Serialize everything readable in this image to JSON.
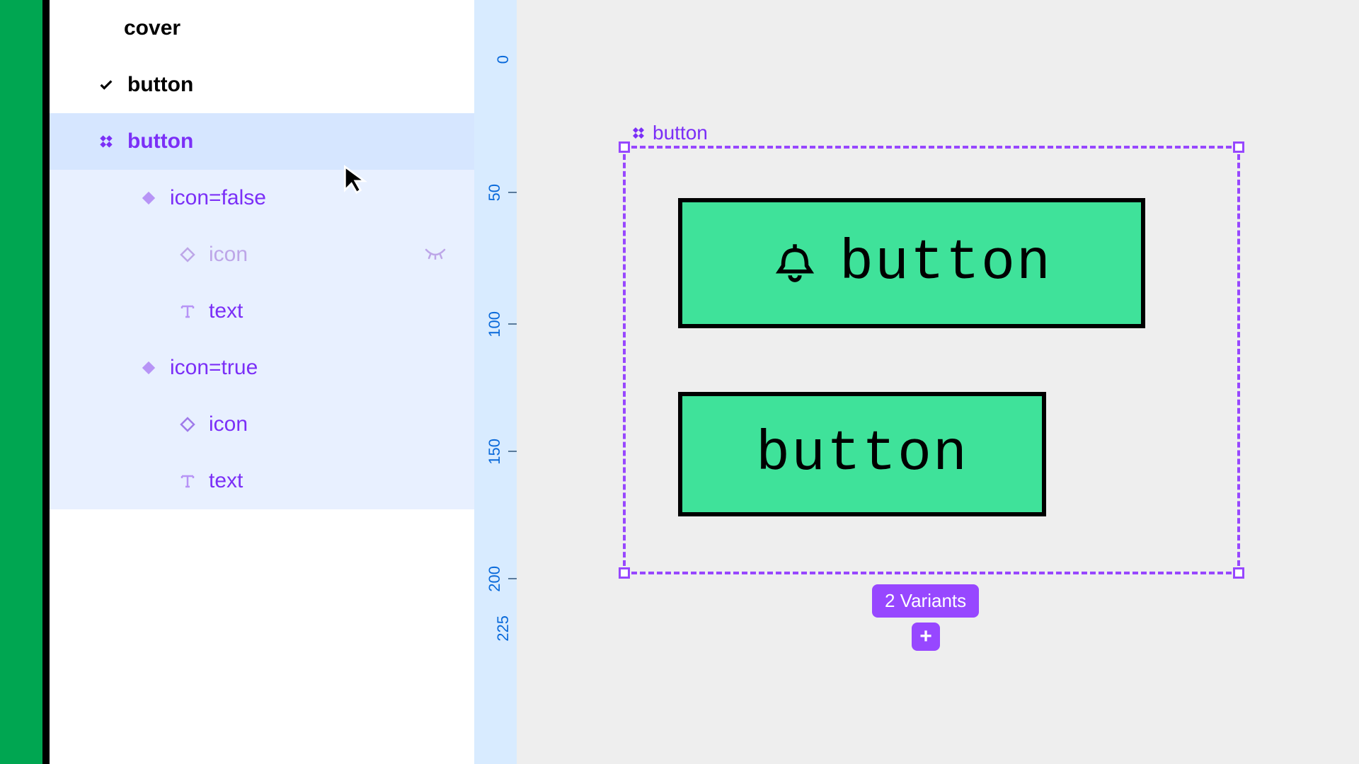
{
  "colors": {
    "accent_green": "#00a651",
    "component_purple": "#9747ff",
    "selection_purple": "#7b2ff7",
    "button_fill": "#3fe29a",
    "ruler_bg": "#d8ebff"
  },
  "layers": {
    "cover": "cover",
    "page": "button",
    "component_set": "button",
    "variants": [
      {
        "name": "icon=false",
        "children": [
          {
            "type": "icon",
            "label": "icon",
            "hidden": true
          },
          {
            "type": "text",
            "label": "text",
            "hidden": false
          }
        ]
      },
      {
        "name": "icon=true",
        "children": [
          {
            "type": "icon",
            "label": "icon",
            "hidden": false
          },
          {
            "type": "text",
            "label": "text",
            "hidden": false
          }
        ]
      }
    ]
  },
  "ruler": {
    "ticks": [
      "0",
      "50",
      "100",
      "150",
      "200",
      "225"
    ]
  },
  "canvas": {
    "frame_label": "button",
    "button_text_1": "button",
    "button_text_2": "button",
    "variants_badge": "2 Variants",
    "add_label": "+"
  }
}
